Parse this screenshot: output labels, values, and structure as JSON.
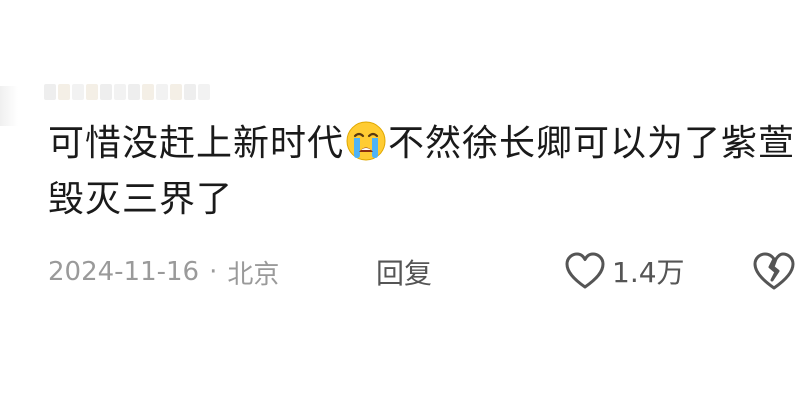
{
  "comment": {
    "text_before_emoji": "可惜没赶上新时代",
    "emoji": "loudly-crying-face-icon",
    "text_after_emoji": "不然徐长卿可以为了紫萱毁灭三界了",
    "date": "2024-11-16",
    "separator": "·",
    "location": "北京",
    "reply_label": "回复",
    "like_count": "1.4万",
    "colors": {
      "text": "#1a1a1a",
      "meta": "#9a9a9a",
      "action": "#555555"
    }
  }
}
